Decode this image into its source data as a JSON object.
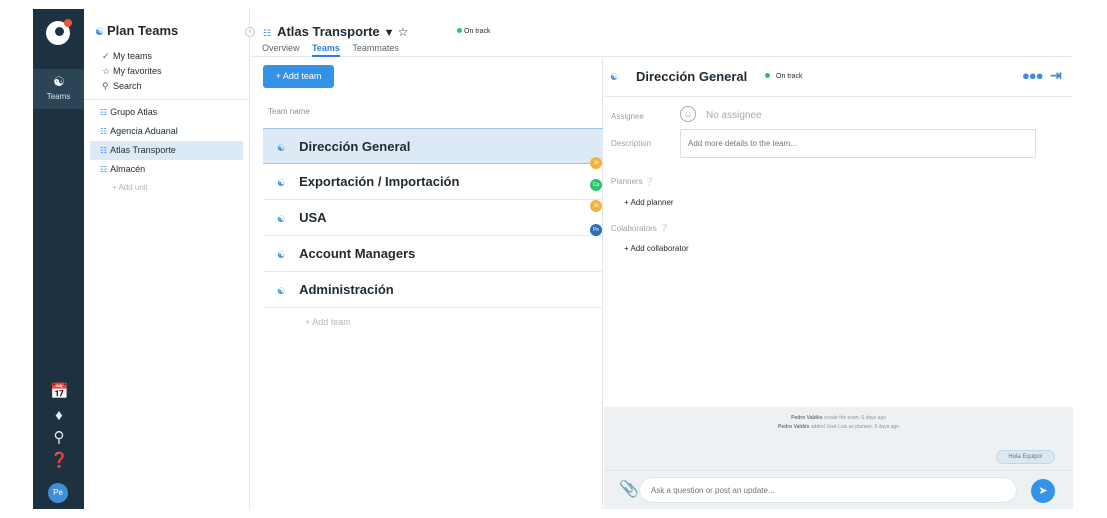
{
  "colors": {
    "rail_bg": "#1e3140",
    "accent": "#3493e8",
    "selected_row": "#dceaf6",
    "on_track": "#27c56a"
  },
  "rail": {
    "nav_label": "Teams",
    "avatar_initials": "Pe",
    "icons": [
      "calendar-check-icon",
      "bell-icon",
      "search-icon",
      "help-icon"
    ]
  },
  "sidebar": {
    "title": "Plan Teams",
    "nav": [
      {
        "label": "My teams",
        "icon": "check-circle-icon"
      },
      {
        "label": "My favorites",
        "icon": "star-icon"
      },
      {
        "label": "Search",
        "icon": "search-icon"
      }
    ],
    "units": [
      {
        "label": "Grupo Atlas",
        "active": false
      },
      {
        "label": "Agencia Aduanal",
        "active": false
      },
      {
        "label": "Atlas Transporte",
        "active": true
      },
      {
        "label": "Almacén",
        "active": false
      }
    ],
    "add_unit": "+ Add unit"
  },
  "header": {
    "title": "Atlas Transporte",
    "status": "On track",
    "tabs": [
      {
        "label": "Overview",
        "active": false
      },
      {
        "label": "Teams",
        "active": true
      },
      {
        "label": "Teammates",
        "active": false
      }
    ]
  },
  "list": {
    "add_button": "+ Add team",
    "column_header": "Team name",
    "rows": [
      {
        "name": "Dirección General",
        "selected": true,
        "avatar": "Jo",
        "avatar_color": "#f2b23c"
      },
      {
        "name": "Exportación / Importación",
        "selected": false,
        "avatar": "Ca",
        "avatar_color": "#2fc46b"
      },
      {
        "name": "USA",
        "selected": false,
        "avatar": "Jo",
        "avatar_color": "#f2b23c"
      },
      {
        "name": "Account Managers",
        "selected": false,
        "avatar": "",
        "avatar_color": ""
      },
      {
        "name": "Administración",
        "selected": false,
        "avatar": "",
        "avatar_color": ""
      }
    ],
    "usa_second_avatar": "Pe",
    "add_row": "+ Add team"
  },
  "detail": {
    "title": "Dirección General",
    "status": "On track",
    "assignee_label": "Assignee",
    "assignee_value": "No assignee",
    "description_label": "Description",
    "description_placeholder": "Add more details to the team...",
    "planners_label": "Planners",
    "add_planner": "+ Add planner",
    "collaborators_label": "Colaborators",
    "add_collaborator": "+ Add collaborator",
    "activity": [
      {
        "user": "Pedro Valdés",
        "text": "create the team. 6 days ago"
      },
      {
        "user": "Pedro Valdés",
        "text": "added José Luis as planner. 6 days ago"
      }
    ],
    "chat_bubble": "Hola Equipo!",
    "composer_placeholder": "Ask a question or post an update..."
  }
}
